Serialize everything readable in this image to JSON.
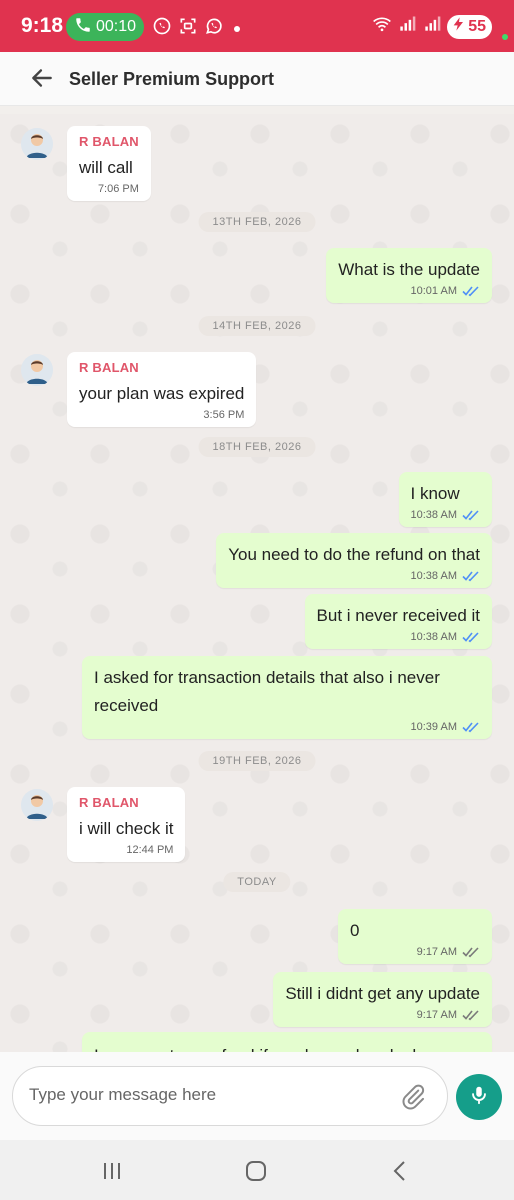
{
  "status_bar": {
    "time": "9:18",
    "call_timer": "00:10",
    "battery": "55",
    "accent_color": "#e0334f"
  },
  "header": {
    "title": "Seller Premium Support",
    "back_icon": "arrow-left-icon"
  },
  "messages": [
    {
      "type": "in",
      "sender": "R BALAN",
      "text": "will call",
      "time": "7:06 PM"
    },
    {
      "type": "date",
      "text": "13TH FEB, 2026"
    },
    {
      "type": "out",
      "text": "What is the update",
      "time": "10:01 AM",
      "status": "read"
    },
    {
      "type": "date",
      "text": "14TH FEB, 2026"
    },
    {
      "type": "in",
      "sender": "R BALAN",
      "text": "your plan was expired",
      "time": "3:56 PM"
    },
    {
      "type": "date",
      "text": "18TH FEB, 2026"
    },
    {
      "type": "out",
      "text": "I know",
      "time": "10:38 AM",
      "status": "read"
    },
    {
      "type": "out",
      "text": "You need to do the refund on that",
      "time": "10:38 AM",
      "status": "read"
    },
    {
      "type": "out",
      "text": "But i never received it",
      "time": "10:38 AM",
      "status": "read"
    },
    {
      "type": "out",
      "text": "I asked for transaction details that also i never received",
      "time": "10:39 AM",
      "status": "read"
    },
    {
      "type": "date",
      "text": "19TH FEB, 2026"
    },
    {
      "type": "in",
      "sender": "R BALAN",
      "text": "i will check it",
      "time": "12:44 PM"
    },
    {
      "type": "date",
      "text": "TODAY"
    },
    {
      "type": "out",
      "text": "0",
      "time": "9:17 AM",
      "status": "delivered"
    },
    {
      "type": "out",
      "text": "Still i didnt get any update",
      "time": "9:17 AM",
      "status": "delivered"
    },
    {
      "type": "out",
      "text": "I never got my refund if you have already done",
      "time": "",
      "status": "partial"
    }
  ],
  "composer": {
    "placeholder": "Type your message here",
    "attach_icon": "paperclip-icon",
    "mic_icon": "microphone-icon",
    "mic_color": "#159e8a"
  },
  "colors": {
    "incoming_bubble": "#ffffff",
    "outgoing_bubble": "#e4fdcf",
    "sender_name": "#e0566a",
    "read_tick": "#4f8ff7",
    "delivered_tick": "#7a7a7a"
  }
}
